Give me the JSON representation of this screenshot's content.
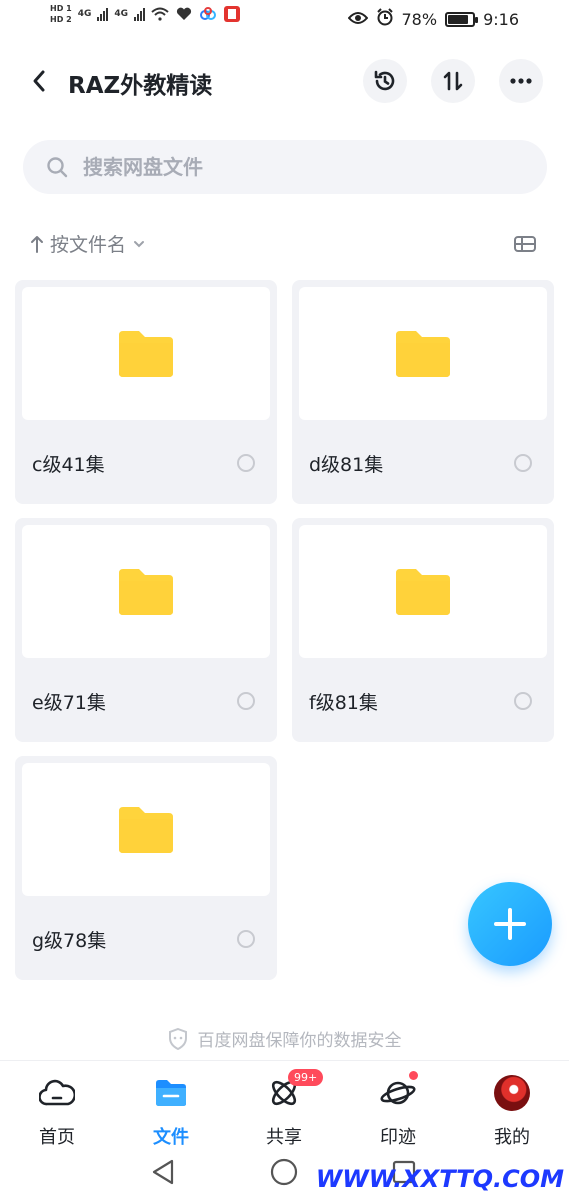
{
  "status_bar": {
    "sim1": "HD 1",
    "sim2": "HD 2",
    "network1": "4G",
    "network2": "4G",
    "battery_percent": "78%",
    "time": "9:16"
  },
  "header": {
    "title": "RAZ外教精读"
  },
  "search": {
    "placeholder": "搜索网盘文件"
  },
  "sort": {
    "label": "按文件名"
  },
  "folders": [
    {
      "name": "c级41集"
    },
    {
      "name": "d级81集"
    },
    {
      "name": "e级71集"
    },
    {
      "name": "f级81集"
    },
    {
      "name": "g级78集"
    }
  ],
  "security_note": "百度网盘保障你的数据安全",
  "bottom_nav": {
    "items": [
      {
        "label": "首页",
        "icon": "cloud-home-icon"
      },
      {
        "label": "文件",
        "icon": "folder-icon"
      },
      {
        "label": "共享",
        "icon": "share-atom-icon",
        "badge": "99+"
      },
      {
        "label": "印迹",
        "icon": "planet-icon"
      },
      {
        "label": "我的",
        "icon": "avatar"
      }
    ]
  },
  "watermark": "WWW.XXTTQ.COM",
  "colors": {
    "accent": "#1c8eff",
    "folder": "#ffd43c",
    "badge": "#ff4a5b"
  }
}
